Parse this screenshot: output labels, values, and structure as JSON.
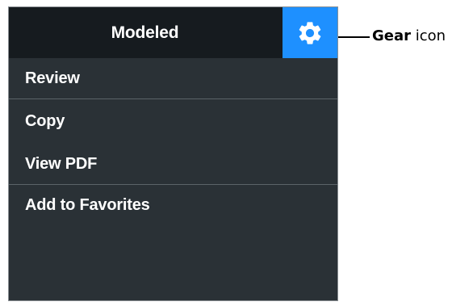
{
  "menu": {
    "header_title": "Modeled",
    "gear_icon": "gear-icon",
    "colors": {
      "panel_background": "#2a3136",
      "header_background": "#161b1f",
      "gear_button_background": "#1e90ff",
      "divider": "#5b6368",
      "text": "#ffffff"
    },
    "items": [
      {
        "label": "Review"
      },
      {
        "label": "Copy"
      },
      {
        "label": "View PDF"
      },
      {
        "label": "Add to Favorites"
      }
    ]
  },
  "callout": {
    "bold_text": "Gear",
    "regular_text": " icon"
  }
}
